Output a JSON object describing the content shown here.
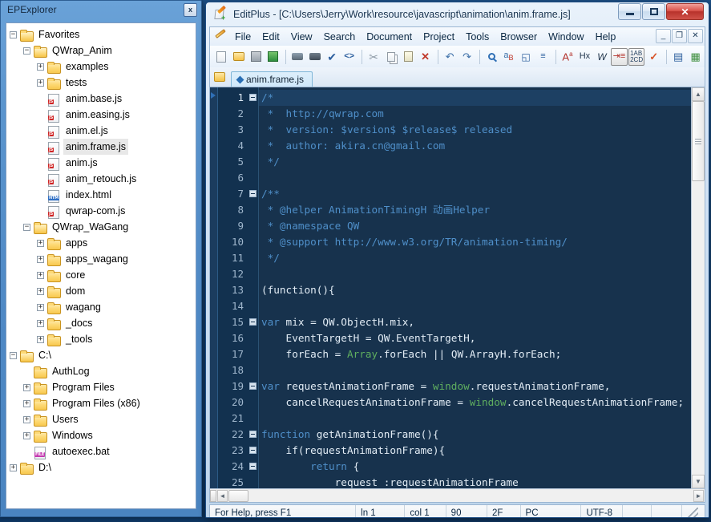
{
  "explorer": {
    "title": "EPExplorer",
    "close_label": "x",
    "tree": [
      {
        "label": "Favorites",
        "depth": 0,
        "twist": "minus",
        "icon": "folder-open"
      },
      {
        "label": "QWrap_Anim",
        "depth": 1,
        "twist": "minus",
        "icon": "folder-open"
      },
      {
        "label": "examples",
        "depth": 2,
        "twist": "plus",
        "icon": "folder"
      },
      {
        "label": "tests",
        "depth": 2,
        "twist": "plus",
        "icon": "folder"
      },
      {
        "label": "anim.base.js",
        "depth": 2,
        "twist": "none",
        "icon": "js-file"
      },
      {
        "label": "anim.easing.js",
        "depth": 2,
        "twist": "none",
        "icon": "js-file"
      },
      {
        "label": "anim.el.js",
        "depth": 2,
        "twist": "none",
        "icon": "js-file"
      },
      {
        "label": "anim.frame.js",
        "depth": 2,
        "twist": "none",
        "icon": "js-file",
        "selected": true
      },
      {
        "label": "anim.js",
        "depth": 2,
        "twist": "none",
        "icon": "js-file"
      },
      {
        "label": "anim_retouch.js",
        "depth": 2,
        "twist": "none",
        "icon": "js-file"
      },
      {
        "label": "index.html",
        "depth": 2,
        "twist": "none",
        "icon": "htm-file"
      },
      {
        "label": "qwrap-com.js",
        "depth": 2,
        "twist": "none",
        "icon": "js-file"
      },
      {
        "label": "QWrap_WaGang",
        "depth": 1,
        "twist": "minus",
        "icon": "folder-open"
      },
      {
        "label": "apps",
        "depth": 2,
        "twist": "plus",
        "icon": "folder"
      },
      {
        "label": "apps_wagang",
        "depth": 2,
        "twist": "plus",
        "icon": "folder"
      },
      {
        "label": "core",
        "depth": 2,
        "twist": "plus",
        "icon": "folder"
      },
      {
        "label": "dom",
        "depth": 2,
        "twist": "plus",
        "icon": "folder"
      },
      {
        "label": "wagang",
        "depth": 2,
        "twist": "plus",
        "icon": "folder"
      },
      {
        "label": "_docs",
        "depth": 2,
        "twist": "plus",
        "icon": "folder"
      },
      {
        "label": "_tools",
        "depth": 2,
        "twist": "plus",
        "icon": "folder"
      },
      {
        "label": "C:\\",
        "depth": 0,
        "twist": "minus",
        "icon": "folder-open"
      },
      {
        "label": "AuthLog",
        "depth": 1,
        "twist": "none",
        "icon": "folder"
      },
      {
        "label": "Program Files",
        "depth": 1,
        "twist": "plus",
        "icon": "folder"
      },
      {
        "label": "Program Files (x86)",
        "depth": 1,
        "twist": "plus",
        "icon": "folder"
      },
      {
        "label": "Users",
        "depth": 1,
        "twist": "plus",
        "icon": "folder"
      },
      {
        "label": "Windows",
        "depth": 1,
        "twist": "plus",
        "icon": "folder"
      },
      {
        "label": "autoexec.bat",
        "depth": 1,
        "twist": "none",
        "icon": "bat-file"
      },
      {
        "label": "D:\\",
        "depth": 0,
        "twist": "plus",
        "icon": "folder"
      }
    ]
  },
  "editplus": {
    "title": "EditPlus - [C:\\Users\\Jerry\\Work\\resource\\javascript\\animation\\anim.frame.js]",
    "window_buttons": {
      "minimize": "minimize-icon",
      "maximize": "maximize-icon",
      "close": "✕"
    },
    "mdi_buttons": {
      "minimize": "_",
      "restore": "❐",
      "close": "✕"
    },
    "menu": [
      "File",
      "Edit",
      "View",
      "Search",
      "Document",
      "Project",
      "Tools",
      "Browser",
      "Window",
      "Help"
    ],
    "toolbar": [
      "new-file-icon",
      "open-file-icon",
      "save-icon",
      "save-all-icon",
      "sep",
      "print-preview-icon",
      "print-icon",
      "spellcheck-icon",
      "view-source-icon",
      "sep",
      "cut-icon",
      "copy-icon",
      "paste-icon",
      "delete-icon",
      "sep",
      "undo-icon",
      "redo-icon",
      "sep",
      "find-icon",
      "replace-icon",
      "find-next-icon",
      "goto-line-icon",
      "sep",
      "font-icon",
      "hex-icon",
      "word-wrap-icon",
      "indent-icon",
      "case-icon",
      "check-icon",
      "sep",
      "document-selector-icon",
      "layout-icon"
    ],
    "tabs": [
      {
        "label": "anim.frame.js",
        "active": true
      }
    ],
    "status": {
      "help_text": "For Help, press F1",
      "line": "ln 1",
      "column": "col 1",
      "char_code": "90",
      "hex_code": "2F",
      "line_ending": "PC",
      "encoding": "UTF-8"
    },
    "editor": {
      "current_line": 1,
      "lines": [
        {
          "n": 1,
          "fold": true,
          "segs": [
            {
              "t": "/*",
              "c": "cmt"
            }
          ]
        },
        {
          "n": 2,
          "fold": false,
          "segs": [
            {
              "t": " *  http://qwrap.com",
              "c": "cmt"
            }
          ]
        },
        {
          "n": 3,
          "fold": false,
          "segs": [
            {
              "t": " *  version: $version$ $release$ released",
              "c": "cmt"
            }
          ]
        },
        {
          "n": 4,
          "fold": false,
          "segs": [
            {
              "t": " *  author: akira.cn@gmail.com",
              "c": "cmt"
            }
          ]
        },
        {
          "n": 5,
          "fold": false,
          "segs": [
            {
              "t": " */",
              "c": "cmt"
            }
          ]
        },
        {
          "n": 6,
          "fold": false,
          "segs": [
            {
              "t": "",
              "c": "cmt"
            }
          ]
        },
        {
          "n": 7,
          "fold": true,
          "segs": [
            {
              "t": "/**",
              "c": "cmt"
            }
          ]
        },
        {
          "n": 8,
          "fold": false,
          "segs": [
            {
              "t": " * @helper AnimationTimingH 动画Helper",
              "c": "cmt"
            }
          ]
        },
        {
          "n": 9,
          "fold": false,
          "segs": [
            {
              "t": " * @namespace QW",
              "c": "cmt"
            }
          ]
        },
        {
          "n": 10,
          "fold": false,
          "segs": [
            {
              "t": " * @support http://www.w3.org/TR/animation-timing/",
              "c": "cmt"
            }
          ]
        },
        {
          "n": 11,
          "fold": false,
          "segs": [
            {
              "t": " */",
              "c": "cmt"
            }
          ]
        },
        {
          "n": 12,
          "fold": false,
          "segs": [
            {
              "t": "",
              "c": "cmt"
            }
          ]
        },
        {
          "n": 13,
          "fold": false,
          "segs": [
            {
              "t": "(function(){",
              "c": "wht"
            }
          ]
        },
        {
          "n": 14,
          "fold": false,
          "segs": [
            {
              "t": "",
              "c": "wht"
            }
          ]
        },
        {
          "n": 15,
          "fold": true,
          "segs": [
            {
              "t": "var",
              "c": "cmt"
            },
            {
              "t": " mix = QW.ObjectH.mix,",
              "c": "wht"
            }
          ]
        },
        {
          "n": 16,
          "fold": false,
          "segs": [
            {
              "t": "    EventTargetH = QW.EventTargetH,",
              "c": "wht"
            }
          ]
        },
        {
          "n": 17,
          "fold": false,
          "segs": [
            {
              "t": "    forEach = ",
              "c": "wht"
            },
            {
              "t": "Array",
              "c": "grn"
            },
            {
              "t": ".forEach || QW.ArrayH.forEach;",
              "c": "wht"
            }
          ]
        },
        {
          "n": 18,
          "fold": false,
          "segs": [
            {
              "t": "",
              "c": "wht"
            }
          ]
        },
        {
          "n": 19,
          "fold": true,
          "segs": [
            {
              "t": "var",
              "c": "cmt"
            },
            {
              "t": " requestAnimationFrame = ",
              "c": "wht"
            },
            {
              "t": "window",
              "c": "grn"
            },
            {
              "t": ".requestAnimationFrame,",
              "c": "wht"
            }
          ]
        },
        {
          "n": 20,
          "fold": false,
          "segs": [
            {
              "t": "    cancelRequestAnimationFrame = ",
              "c": "wht"
            },
            {
              "t": "window",
              "c": "grn"
            },
            {
              "t": ".cancelRequestAnimationFrame;",
              "c": "wht"
            }
          ]
        },
        {
          "n": 21,
          "fold": false,
          "segs": [
            {
              "t": "",
              "c": "wht"
            }
          ]
        },
        {
          "n": 22,
          "fold": true,
          "segs": [
            {
              "t": "function",
              "c": "cmt"
            },
            {
              "t": " getAnimationFrame(){",
              "c": "wht"
            }
          ]
        },
        {
          "n": 23,
          "fold": true,
          "segs": [
            {
              "t": "    if(requestAnimationFrame){",
              "c": "wht"
            }
          ]
        },
        {
          "n": 24,
          "fold": true,
          "segs": [
            {
              "t": "        ",
              "c": "wht"
            },
            {
              "t": "return",
              "c": "cmt"
            },
            {
              "t": " {",
              "c": "wht"
            }
          ]
        },
        {
          "n": 25,
          "fold": false,
          "segs": [
            {
              "t": "            request :requestAnimationFrame",
              "c": "wht"
            }
          ]
        }
      ]
    }
  },
  "colors": {
    "editor_bg": "#17324f",
    "gutter_bg": "#12314f",
    "comment": "#4f8fc9",
    "string_green": "#5fae5f",
    "text": "#e2ecf5",
    "current_line": "#1d4063",
    "desktop": "#15406e",
    "titlebar_blue": "#5b95ce",
    "close_red": "#d9534a"
  }
}
